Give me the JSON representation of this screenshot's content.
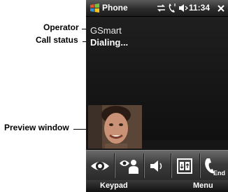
{
  "annotations": {
    "operator": "Operator",
    "call_status": "Call status",
    "preview_window": "Preview window"
  },
  "titlebar": {
    "app_title": "Phone",
    "time": "11:34"
  },
  "call": {
    "operator_name": "GSmart",
    "status": "Dialing..."
  },
  "toolbar": {
    "end_label": "End"
  },
  "softkeys": {
    "left": "Keypad",
    "right": "Menu"
  },
  "colors": {
    "toolbar": "#4a4a4a",
    "screen": "#161616"
  }
}
